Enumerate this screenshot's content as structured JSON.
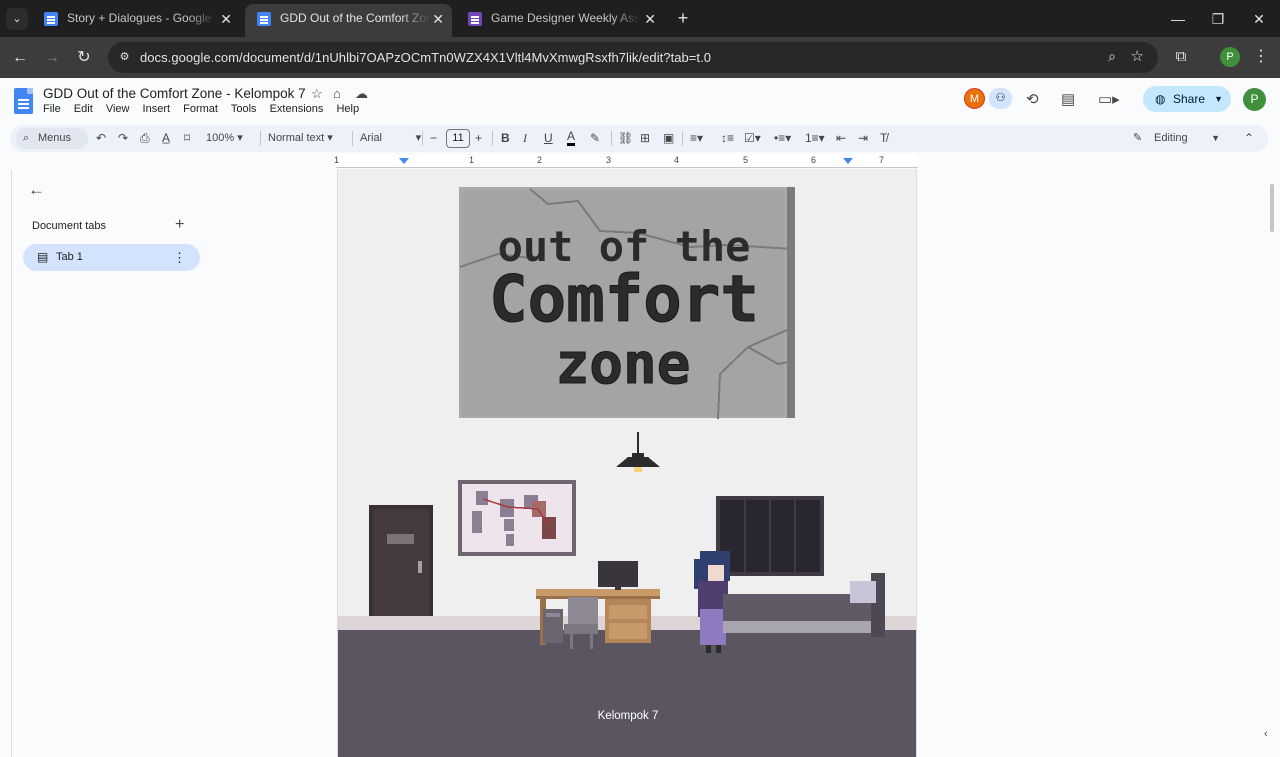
{
  "browser": {
    "tabs": [
      {
        "title": "Story + Dialogues - Google Docs",
        "icon": "google-docs-icon",
        "active": false
      },
      {
        "title": "GDD Out of the Comfort Zone",
        "icon": "google-docs-icon",
        "active": true
      },
      {
        "title": "Game Designer Weekly Assignment",
        "icon": "google-forms-icon",
        "active": false
      }
    ],
    "url": "docs.google.com/document/d/1nUhlbi7OAPzOCmTn0WZX4X1Vltl4MvXmwgRsxfh7lik/edit?tab=t.0",
    "profile_initial": "P"
  },
  "docs": {
    "title": "GDD Out of the Comfort Zone - Kelompok 7",
    "menu": [
      "File",
      "Edit",
      "View",
      "Insert",
      "Format",
      "Tools",
      "Extensions",
      "Help"
    ],
    "collaborator_initial": "M",
    "share_label": "Share",
    "user_initial": "P"
  },
  "toolbar": {
    "menus_label": "Menus",
    "zoom": "100%",
    "style": "Normal text",
    "font": "Arial",
    "font_size": "11",
    "mode": "Editing"
  },
  "ruler": {
    "numbers": [
      "1",
      "1",
      "2",
      "3",
      "4",
      "5",
      "6",
      "7"
    ]
  },
  "sidebar": {
    "heading": "Document tabs",
    "tabs": [
      {
        "label": "Tab 1"
      }
    ]
  },
  "page": {
    "title_sign": [
      "out of the",
      "Comfort",
      "zone"
    ],
    "caption": "Kelompok 7"
  },
  "colors": {
    "docs_blue": "#4285f4",
    "share_bg": "#c2e7ff",
    "selected_tab_bg": "#d3e3fd",
    "room_floor": "#5a5560",
    "room_wall": "#efefef"
  }
}
